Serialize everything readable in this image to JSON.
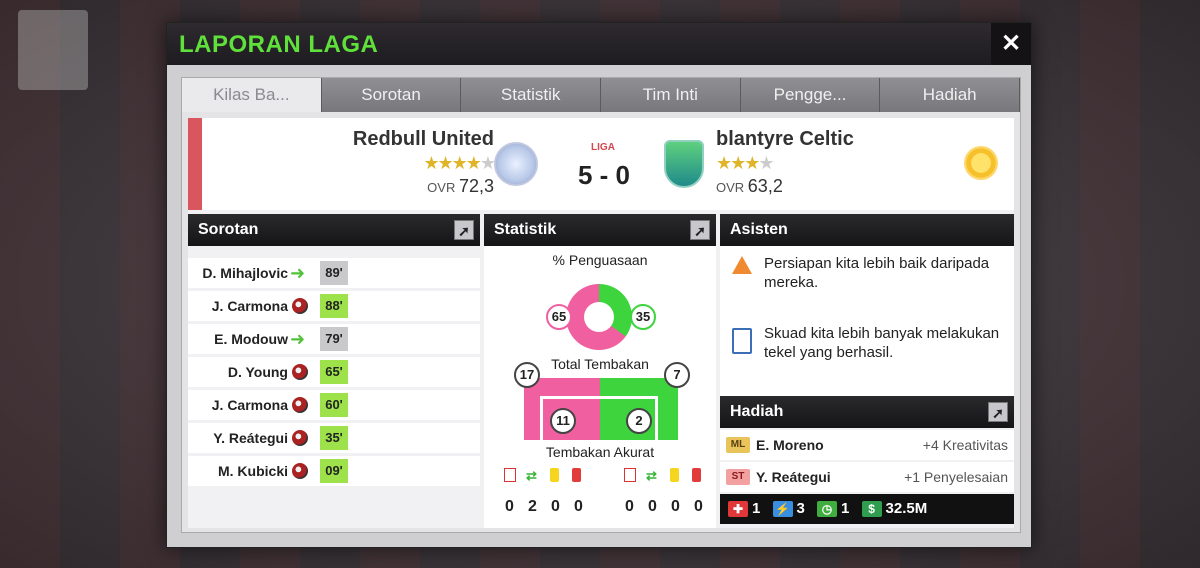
{
  "title": "LAPORAN LAGA",
  "tabs": [
    "Kilas Ba...",
    "Sorotan",
    "Statistik",
    "Tim Inti",
    "Pengge...",
    "Hadiah"
  ],
  "match": {
    "home": {
      "name": "Redbull United",
      "stars": "★★★★★",
      "ovr_label": "OVR",
      "ovr": "72,3"
    },
    "away": {
      "name": "blantyre Celtic",
      "stars": "★★★★★",
      "ovr_label": "OVR",
      "ovr": "63,2"
    },
    "competition": "LIGA",
    "score": "5 - 0"
  },
  "sorotan": {
    "header": "Sorotan",
    "items": [
      {
        "name": "D. Mihajlovic",
        "event": "sub",
        "minute": "89'",
        "min_style": "grey"
      },
      {
        "name": "J. Carmona",
        "event": "goal",
        "minute": "88'",
        "min_style": "green"
      },
      {
        "name": "E. Modouw",
        "event": "sub",
        "minute": "79'",
        "min_style": "grey"
      },
      {
        "name": "D. Young",
        "event": "goal",
        "minute": "65'",
        "min_style": "green"
      },
      {
        "name": "J. Carmona",
        "event": "goal",
        "minute": "60'",
        "min_style": "green"
      },
      {
        "name": "Y. Reátegui",
        "event": "goal",
        "minute": "35'",
        "min_style": "green"
      },
      {
        "name": "M. Kubicki",
        "event": "goal",
        "minute": "09'",
        "min_style": "green"
      }
    ]
  },
  "statistik": {
    "header": "Statistik",
    "possession_label": "% Penguasaan",
    "possession": {
      "home": "65",
      "away": "35"
    },
    "shots_label": "Total Tembakan",
    "shots": {
      "home": "17",
      "away": "7"
    },
    "accurate_label": "Tembakan Akurat",
    "accurate": {
      "home": "11",
      "away": "2"
    },
    "home_counts": [
      "0",
      "2",
      "0",
      "0"
    ],
    "away_counts": [
      "0",
      "0",
      "0",
      "0"
    ]
  },
  "asisten": {
    "header": "Asisten",
    "tips": [
      "Persiapan kita lebih baik daripada mereka.",
      "Skuad kita lebih banyak melakukan tekel yang berhasil."
    ]
  },
  "hadiah": {
    "header": "Hadiah",
    "rows": [
      {
        "pos": "ML",
        "name": "E. Moreno",
        "value": "+4 Kreativitas"
      },
      {
        "pos": "ST",
        "name": "Y. Reátegui",
        "value": "+1 Penyelesaian"
      }
    ],
    "footer": {
      "medical": "1",
      "energy": "3",
      "time": "1",
      "cash": "32.5M"
    }
  }
}
